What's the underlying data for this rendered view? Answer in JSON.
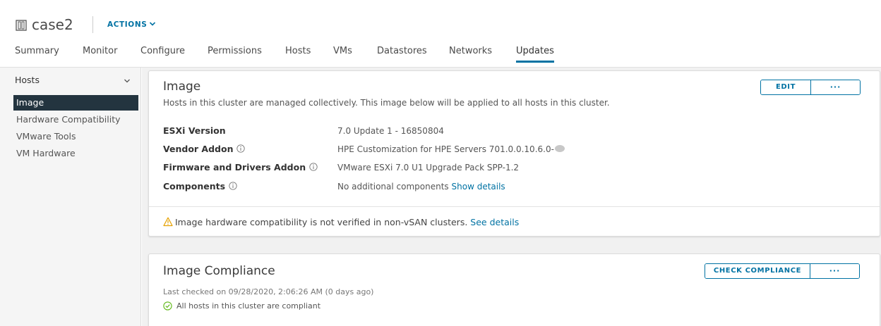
{
  "header": {
    "object_name": "case2",
    "object_icon": "cluster-icon",
    "actions_label": "ACTIONS",
    "accent_color": "#0072a3"
  },
  "tabs": [
    {
      "label": "Summary"
    },
    {
      "label": "Monitor"
    },
    {
      "label": "Configure"
    },
    {
      "label": "Permissions"
    },
    {
      "label": "Hosts"
    },
    {
      "label": "VMs"
    },
    {
      "label": "Datastores"
    },
    {
      "label": "Networks"
    },
    {
      "label": "Updates",
      "active": true
    }
  ],
  "sidebar": {
    "group_label": "Hosts",
    "selected_color": "#23343f",
    "items": [
      {
        "label": "Image",
        "selected": true
      },
      {
        "label": "Hardware Compatibility"
      },
      {
        "label": "VMware Tools"
      },
      {
        "label": "VM Hardware"
      }
    ]
  },
  "image_card": {
    "title": "Image",
    "description": "Hosts in this cluster are managed collectively. This image below will be applied to all hosts in this cluster.",
    "edit_label": "EDIT",
    "more_label": "···",
    "rows": [
      {
        "label": "ESXi Version",
        "value": "7.0 Update 1 - 16850804"
      },
      {
        "label": "Vendor Addon",
        "value": "HPE Customization for HPE Servers 701.0.0.10.6.0-"
      },
      {
        "label": "Firmware and Drivers Addon",
        "value": "VMware ESXi 7.0 U1 Upgrade Pack SPP-1.2"
      },
      {
        "label": "Components",
        "value": "No additional components",
        "link": "Show details"
      }
    ],
    "warning_text": "Image hardware compatibility is not verified in non-vSAN clusters.",
    "warning_link": "See details",
    "warning_color": "#e6a100"
  },
  "compliance_card": {
    "title": "Image Compliance",
    "check_label": "CHECK COMPLIANCE",
    "more_label": "···",
    "last_checked": "Last checked on 09/28/2020, 2:06:26 AM (0 days ago)",
    "status_text": "All hosts in this cluster are compliant",
    "status_color": "#5eb715"
  }
}
